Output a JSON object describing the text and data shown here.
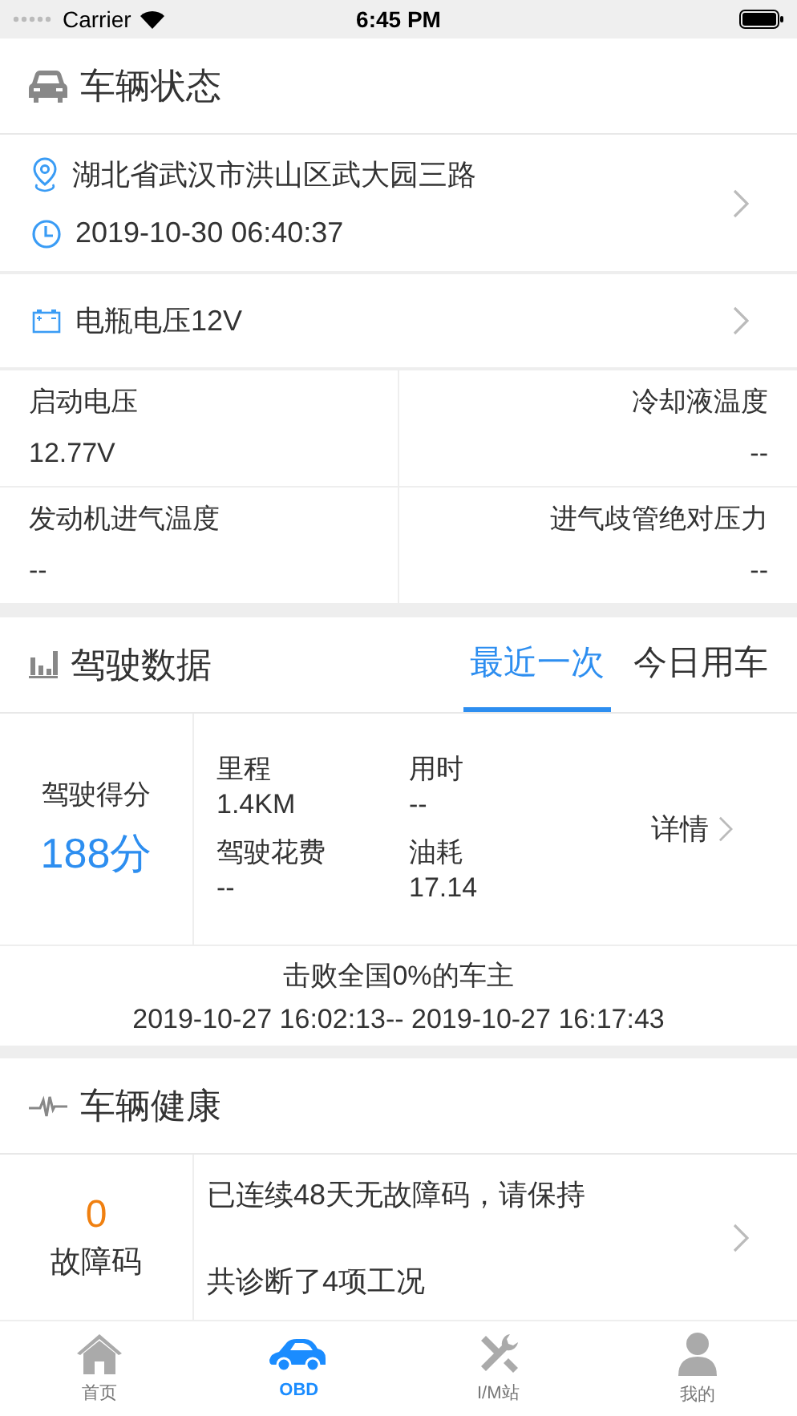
{
  "status_bar": {
    "carrier": "Carrier",
    "time": "6:45 PM"
  },
  "vehicle_status": {
    "title": "车辆状态",
    "address": "湖北省武汉市洪山区武大园三路",
    "time": "2019-10-30 06:40:37",
    "battery": "电瓶电压12V",
    "readings": [
      {
        "label": "启动电压",
        "value": "12.77V"
      },
      {
        "label": "冷却液温度",
        "value": "--"
      },
      {
        "label": "发动机进气温度",
        "value": "--"
      },
      {
        "label": "进气歧管绝对压力",
        "value": "--"
      }
    ]
  },
  "driving_data": {
    "title": "驾驶数据",
    "tabs": [
      {
        "label": "最近一次",
        "selected": true
      },
      {
        "label": "今日用车",
        "selected": false
      }
    ],
    "score_label": "驾驶得分",
    "score": "188分",
    "stats": [
      {
        "label": "里程",
        "value": "1.4KM"
      },
      {
        "label": "用时",
        "value": "--"
      },
      {
        "label": "驾驶花费",
        "value": "--"
      },
      {
        "label": "油耗",
        "value": "17.14"
      }
    ],
    "details": "详情",
    "summary": "击败全国0%的车主",
    "period": "2019-10-27 16:02:13-- 2019-10-27 16:17:43"
  },
  "vehicle_health": {
    "title": "车辆健康",
    "fault_count": "0",
    "fault_label": "故障码",
    "message": "已连续48天无故障码，请保持",
    "diagnosis": "共诊断了4项工况"
  },
  "tab_bar": [
    {
      "label": "首页",
      "kind": "home",
      "selected": false
    },
    {
      "label": "OBD",
      "kind": "car",
      "selected": true
    },
    {
      "label": "I/M站",
      "kind": "tools",
      "selected": false
    },
    {
      "label": "我的",
      "kind": "person",
      "selected": false
    }
  ]
}
